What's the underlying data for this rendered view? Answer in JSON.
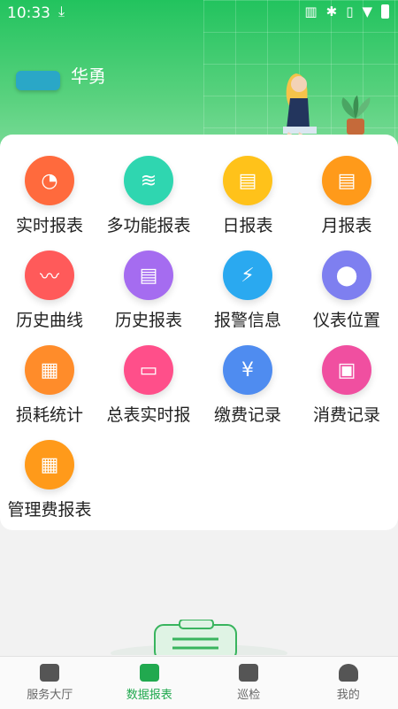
{
  "status": {
    "time": "10:33"
  },
  "header": {
    "username": "华勇"
  },
  "grid": [
    {
      "label": "实时报表",
      "color": "#ff6a3d",
      "icon": "pie-chart-icon"
    },
    {
      "label": "多功能报表",
      "color": "#2fd6b0",
      "icon": "layers-icon"
    },
    {
      "label": "日报表",
      "color": "#ffc21a",
      "icon": "daily-report-icon"
    },
    {
      "label": "月报表",
      "color": "#ff9a1a",
      "icon": "monthly-report-icon"
    },
    {
      "label": "历史曲线",
      "color": "#ff5a5a",
      "icon": "curve-icon"
    },
    {
      "label": "历史报表",
      "color": "#a56cf0",
      "icon": "history-report-icon"
    },
    {
      "label": "报警信息",
      "color": "#2aa9f0",
      "icon": "alarm-icon"
    },
    {
      "label": "仪表位置",
      "color": "#7e7ff0",
      "icon": "location-icon"
    },
    {
      "label": "损耗统计",
      "color": "#ff8c2a",
      "icon": "loss-chart-icon"
    },
    {
      "label": "总表实时报",
      "color": "#ff4f8a",
      "icon": "meter-icon"
    },
    {
      "label": "缴费记录",
      "color": "#4f8cf0",
      "icon": "payment-icon"
    },
    {
      "label": "消费记录",
      "color": "#f04fa0",
      "icon": "wallet-icon"
    },
    {
      "label": "管理费报表",
      "color": "#ff9a1a",
      "icon": "management-fee-icon"
    }
  ],
  "tabs": [
    {
      "label": "服务大厅",
      "icon": "service-hall-icon",
      "active": false
    },
    {
      "label": "数据报表",
      "icon": "data-report-icon",
      "active": true
    },
    {
      "label": "巡检",
      "icon": "inspection-icon",
      "active": false
    },
    {
      "label": "我的",
      "icon": "profile-icon",
      "active": false
    }
  ]
}
